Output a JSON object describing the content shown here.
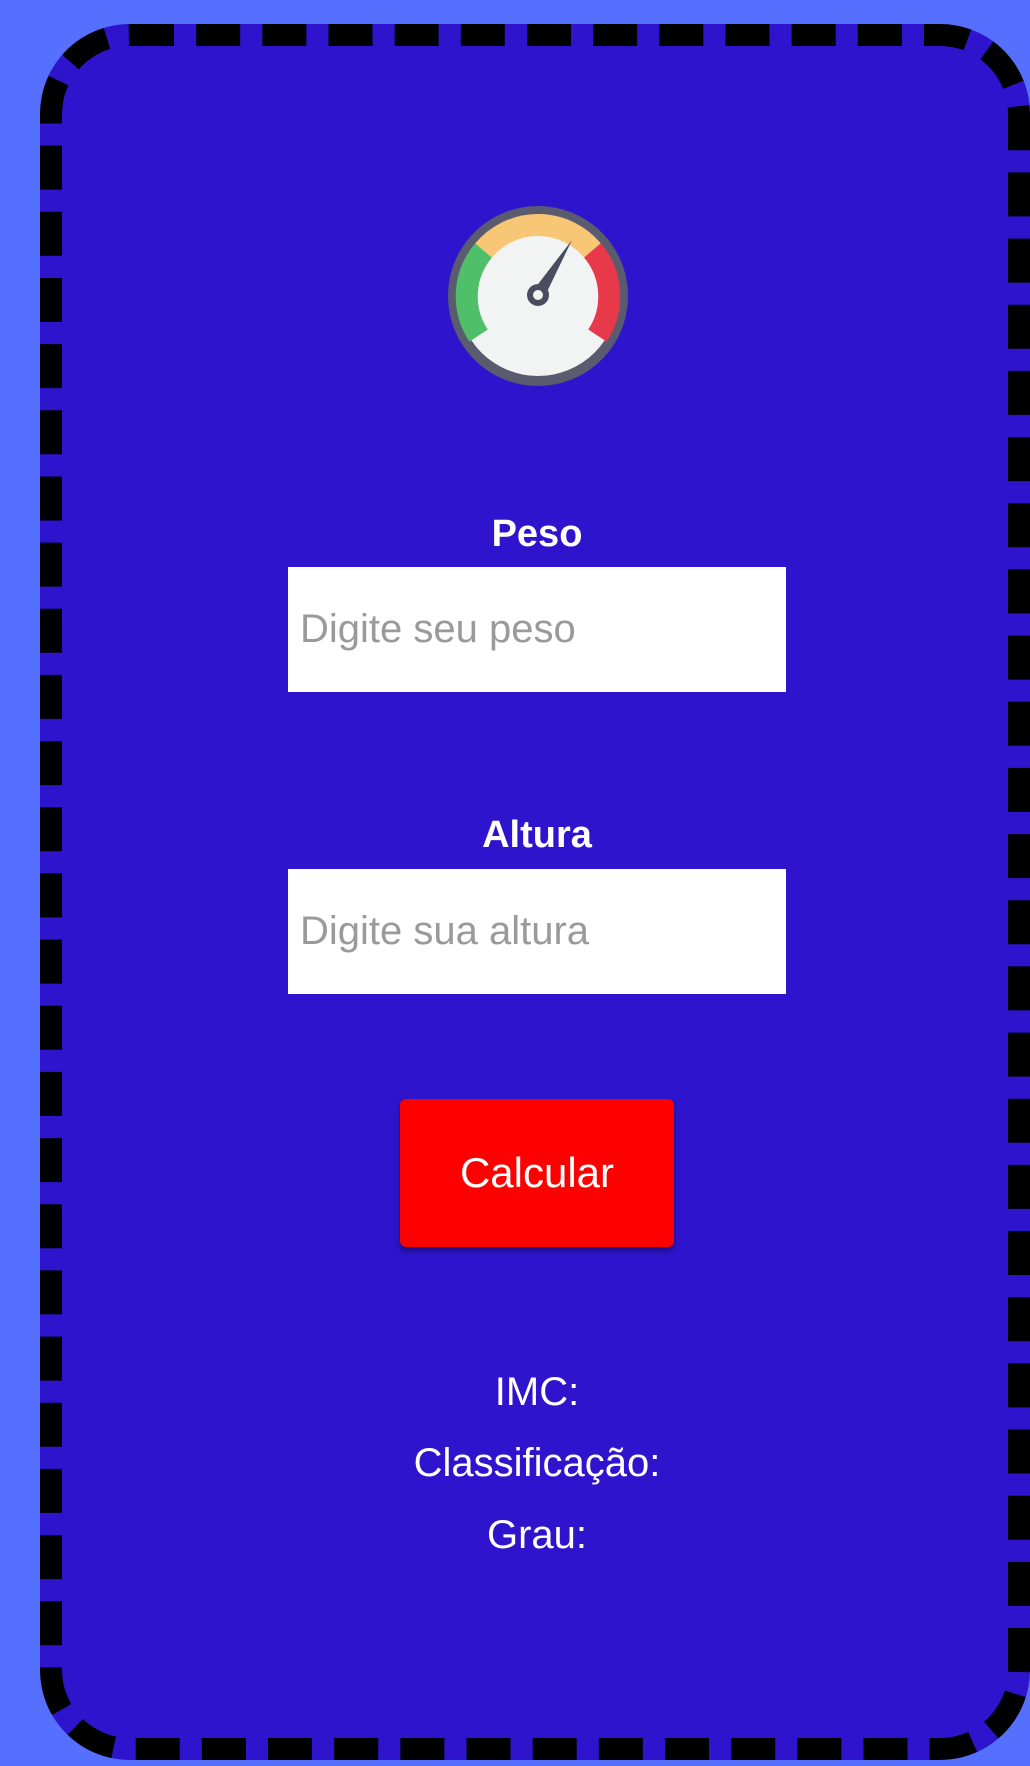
{
  "colors": {
    "page_background": "#5570ff",
    "card_background": "#2e14cc",
    "card_border": "#000000",
    "input_background": "#ffffff",
    "placeholder_text": "#9a9a9a",
    "button_background": "#ff0000",
    "text": "#ffffff"
  },
  "logo": {
    "icon": "speedometer-gauge-icon"
  },
  "form": {
    "peso": {
      "label": "Peso",
      "placeholder": "Digite seu peso",
      "value": ""
    },
    "altura": {
      "label": "Altura",
      "placeholder": "Digite sua altura",
      "value": ""
    },
    "calculate_label": "Calcular"
  },
  "results": {
    "imc_label": "IMC:",
    "classificacao_label": "Classificação:",
    "grau_label": "Grau:"
  }
}
